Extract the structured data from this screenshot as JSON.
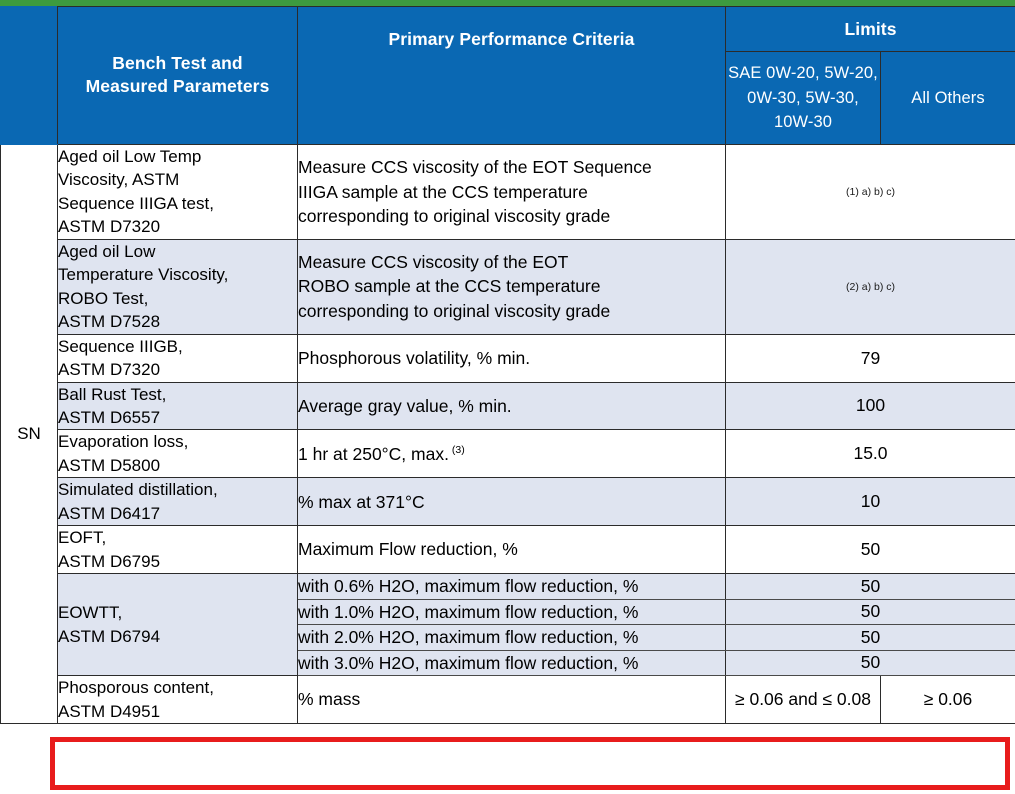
{
  "theme": {
    "header_blue": "#0a68b3",
    "accent_green": "#3d9b3f",
    "highlight_red": "#e81c1c",
    "row_shade": "#dfe4f0"
  },
  "header": {
    "col_test_line1": "Bench Test and",
    "col_test_line2": "Measured Parameters",
    "col_criteria": "Primary Performance Criteria",
    "col_limits": "Limits",
    "col_limits_sub1_line1": "SAE 0W-20,",
    "col_limits_sub1_line2": "5W-20, 0W-30,",
    "col_limits_sub1_line3": "5W-30, 10W-30",
    "col_limits_sub2": "All Others"
  },
  "category": {
    "label": "SN"
  },
  "rows": [
    {
      "test_lines": [
        "Aged oil Low Temp",
        "Viscosity, ASTM",
        "Sequence IIIGA test,",
        "ASTM D7320"
      ],
      "criteria_lines": [
        "Measure CCS viscosity of the EOT Sequence",
        "IIIGA sample at the CCS temperature",
        "corresponding to original viscosity grade"
      ],
      "limit_merged": "(1) a) b) c)",
      "shaded": false,
      "is_note": true
    },
    {
      "test_lines": [
        "Aged oil Low",
        "Temperature Viscosity,",
        "ROBO Test,",
        "ASTM D7528"
      ],
      "criteria_lines": [
        "Measure CCS viscosity of the EOT",
        "ROBO sample at the CCS temperature",
        "corresponding to original viscosity grade"
      ],
      "limit_merged": "(2) a) b) c)",
      "shaded": true,
      "is_note": true
    },
    {
      "test_lines": [
        "Sequence IIIGB,",
        "ASTM D7320"
      ],
      "criteria_lines": [
        "Phosphorous volatility, % min."
      ],
      "limit_merged": "79",
      "shaded": false,
      "is_note": false
    },
    {
      "test_lines": [
        "Ball Rust Test,",
        "ASTM D6557"
      ],
      "criteria_lines": [
        "Average gray value, % min."
      ],
      "limit_merged": "100",
      "shaded": true,
      "is_note": false
    },
    {
      "test_lines": [
        "Evaporation loss,",
        "ASTM D5800"
      ],
      "criteria_lines": [
        "1 hr at 250°C, max."
      ],
      "criteria_footnote": "(3)",
      "limit_merged": "15.0",
      "shaded": false,
      "is_note": false
    },
    {
      "test_lines": [
        "Simulated distillation,",
        "ASTM D6417"
      ],
      "criteria_lines": [
        " % max at 371°C"
      ],
      "limit_merged": "10",
      "shaded": true,
      "is_note": false
    },
    {
      "test_lines": [
        "EOFT,",
        "ASTM D6795"
      ],
      "criteria_lines": [
        "Maximum Flow reduction, %"
      ],
      "limit_merged": "50",
      "shaded": false,
      "is_note": false
    }
  ],
  "eowtt": {
    "test_lines": [
      "EOWTT,",
      "ASTM D6794"
    ],
    "shaded": true,
    "sub_rows": [
      {
        "criteria": "with 0.6% H2O, maximum flow reduction, %",
        "limit_merged": "50"
      },
      {
        "criteria": "with 1.0% H2O, maximum flow reduction, %",
        "limit_merged": "50"
      },
      {
        "criteria": "with 2.0% H2O, maximum flow reduction, %",
        "limit_merged": "50"
      },
      {
        "criteria": "with 3.0% H2O, maximum flow reduction, %",
        "limit_merged": "50"
      }
    ]
  },
  "highlighted_row": {
    "test_lines": [
      "Phosporous content,",
      "ASTM D4951"
    ],
    "criteria": "% mass",
    "limit_sae": "≥ 0.06 and ≤ 0.08",
    "limit_others": "≥ 0.06",
    "shaded": false
  }
}
